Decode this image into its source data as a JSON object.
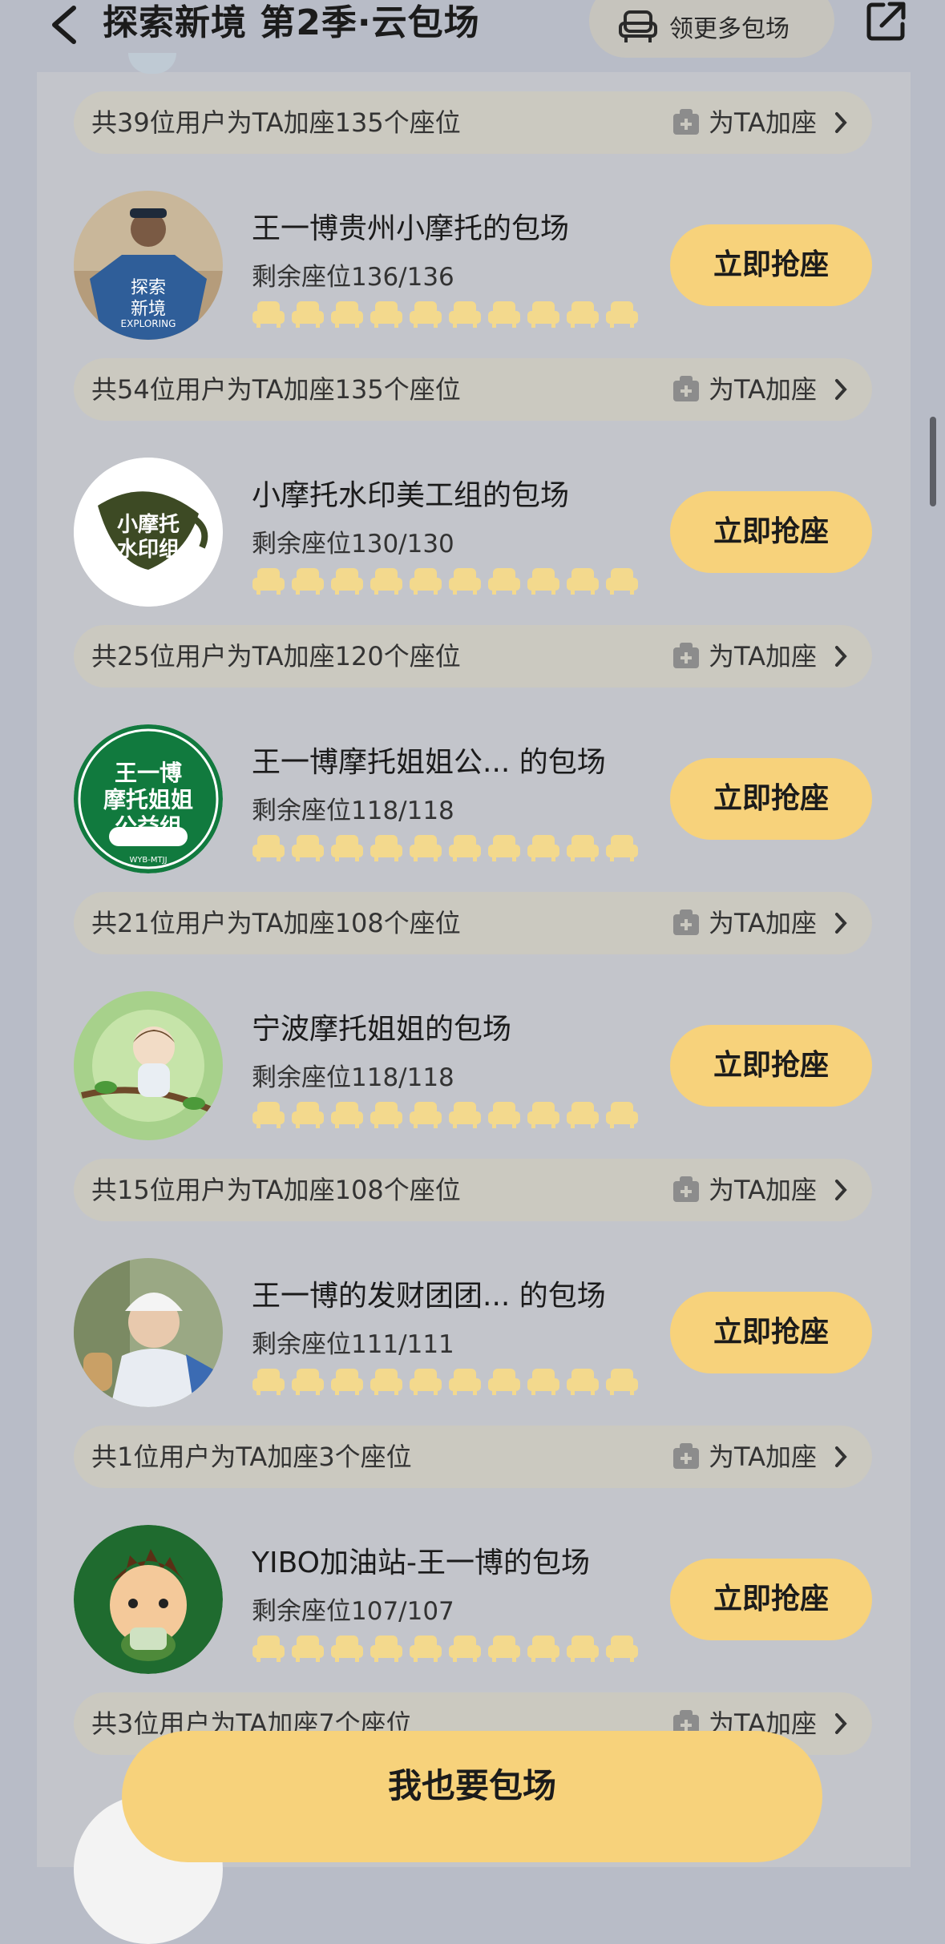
{
  "header": {
    "title": "探索新境 第2季·云包场",
    "more_label": "领更多包场"
  },
  "strips": [
    {
      "text": "共39位用户为TA加座135个座位",
      "action": "为TA加座"
    },
    {
      "text": "共54位用户为TA加座135个座位",
      "action": "为TA加座"
    },
    {
      "text": "共25位用户为TA加座120个座位",
      "action": "为TA加座"
    },
    {
      "text": "共21位用户为TA加座108个座位",
      "action": "为TA加座"
    },
    {
      "text": "共15位用户为TA加座108个座位",
      "action": "为TA加座"
    },
    {
      "text": "共1位用户为TA加座3个座位",
      "action": "为TA加座"
    },
    {
      "text": "共3位用户为TA加座7个座位",
      "action": "为TA加座"
    }
  ],
  "rooms": [
    {
      "name": "王一博贵州小摩托的包场",
      "seats": "剩余座位136/136",
      "button": "立即抢座",
      "avatar_text": "探索\n新境",
      "avatar_sub": "EXPLORING"
    },
    {
      "name": "小摩托水印美工组的包场",
      "seats": "剩余座位130/130",
      "button": "立即抢座",
      "avatar_text": "小摩托\n水印组"
    },
    {
      "name": "王一博摩托姐姐公... 的包场",
      "seats": "剩余座位118/118",
      "button": "立即抢座",
      "avatar_text": "王一博\n摩托姐姐\n公益组",
      "avatar_sub": "WYB-MTJJ"
    },
    {
      "name": "宁波摩托姐姐的包场",
      "seats": "剩余座位118/118",
      "button": "立即抢座"
    },
    {
      "name": "王一博的发财团团... 的包场",
      "seats": "剩余座位111/111",
      "button": "立即抢座"
    },
    {
      "name": "YIBO加油站-王一博的包场",
      "seats": "剩余座位107/107",
      "button": "立即抢座"
    }
  ],
  "bottom_button": "我也要包场",
  "colors": {
    "accent": "#f7d27b",
    "seat_icon": "#f3d98d",
    "panel": "#c3c5cb",
    "strip": "#cbc9c0"
  },
  "icons": {
    "back": "chevron-left-icon",
    "more": "sofa-icon",
    "share": "share-icon",
    "strip_action": "gift-icon",
    "strip_chevron": "chevron-right-icon",
    "seat": "seat-icon"
  }
}
